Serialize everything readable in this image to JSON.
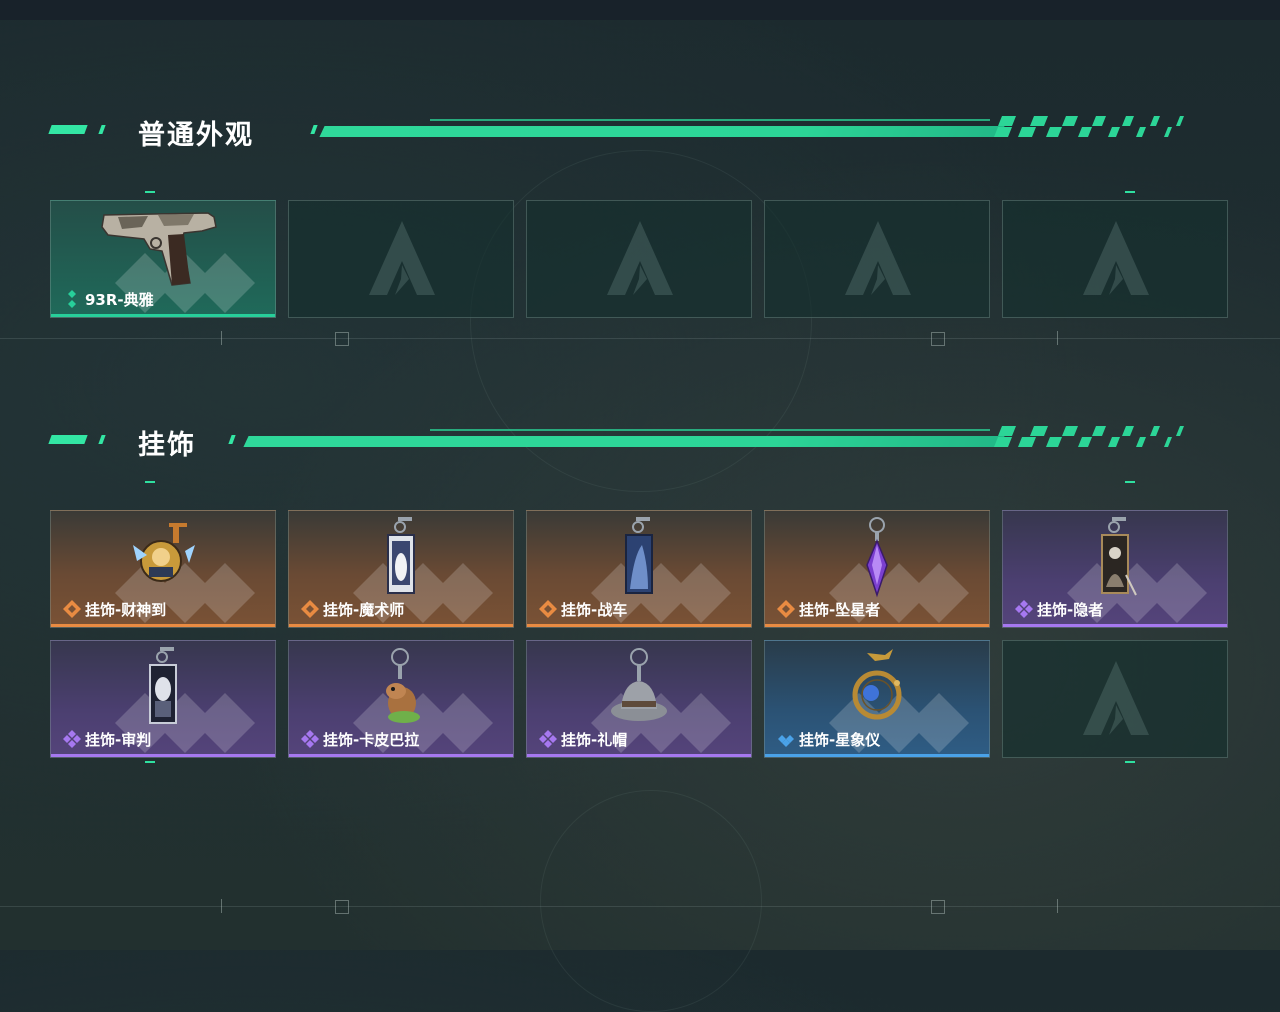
{
  "sections": [
    {
      "title": "普通外观",
      "items": [
        {
          "name": "93R-典雅",
          "rarity": "green",
          "icon": "pistol-icon"
        },
        {
          "name": "",
          "rarity": "empty",
          "icon": "empty-slot-icon"
        },
        {
          "name": "",
          "rarity": "empty",
          "icon": "empty-slot-icon"
        },
        {
          "name": "",
          "rarity": "empty",
          "icon": "empty-slot-icon"
        },
        {
          "name": "",
          "rarity": "empty",
          "icon": "empty-slot-icon"
        }
      ]
    },
    {
      "title": "挂饰",
      "items": [
        {
          "name": "挂饰-财神到",
          "rarity": "orange",
          "icon": "fortune-charm-icon"
        },
        {
          "name": "挂饰-魔术师",
          "rarity": "orange",
          "icon": "tarot-card-charm-icon"
        },
        {
          "name": "挂饰-战车",
          "rarity": "orange",
          "icon": "tarot-card-charm-icon"
        },
        {
          "name": "挂饰-坠星者",
          "rarity": "orange",
          "icon": "crystal-charm-icon"
        },
        {
          "name": "挂饰-隐者",
          "rarity": "purple",
          "icon": "tarot-card-charm-icon"
        },
        {
          "name": "挂饰-审判",
          "rarity": "purple",
          "icon": "tarot-card-charm-icon"
        },
        {
          "name": "挂饰-卡皮巴拉",
          "rarity": "purple",
          "icon": "capybara-charm-icon"
        },
        {
          "name": "挂饰-礼帽",
          "rarity": "purple",
          "icon": "hat-charm-icon"
        },
        {
          "name": "挂饰-星象仪",
          "rarity": "blue",
          "icon": "astrolabe-charm-icon"
        },
        {
          "name": "",
          "rarity": "empty",
          "icon": "empty-slot-icon"
        }
      ]
    }
  ],
  "colors": {
    "accent": "#33e6a4",
    "rarity_green": "#27cf9a",
    "rarity_orange": "#e98b42",
    "rarity_purple": "#a678f0",
    "rarity_blue": "#4aa2e8"
  }
}
